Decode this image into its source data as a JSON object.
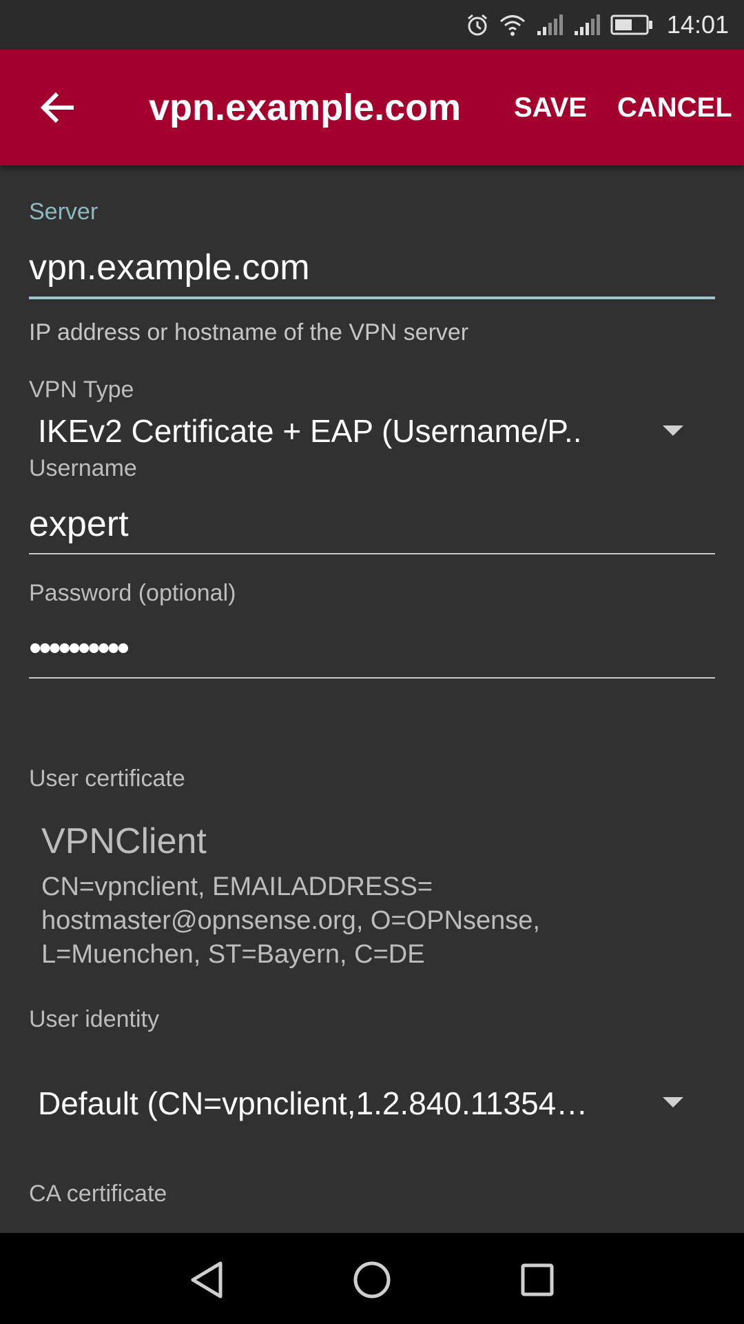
{
  "status_bar": {
    "time": "14:01",
    "icons": [
      "alarm-icon",
      "wifi-icon",
      "signal-icon",
      "signal-icon",
      "battery-icon"
    ]
  },
  "app_bar": {
    "title": "vpn.example.com",
    "save_label": "SAVE",
    "cancel_label": "CANCEL",
    "back_icon": "arrow-back-icon",
    "background_color": "#a4002d"
  },
  "form": {
    "server": {
      "label": "Server",
      "value": "vpn.example.com",
      "helper": "IP address or hostname of the VPN server"
    },
    "vpn_type": {
      "label": "VPN Type",
      "value": "IKEv2 Certificate + EAP (Username/P.."
    },
    "username": {
      "label": "Username",
      "value": "expert"
    },
    "password": {
      "label": "Password (optional)",
      "value": "••••••••••"
    },
    "user_certificate": {
      "label": "User certificate",
      "name": "VPNClient",
      "subject_lines": [
        "CN=vpnclient, EMAILADDRESS=",
        "hostmaster@opnsense.org, O=OPNsense,",
        "L=Muenchen, ST=Bayern, C=DE"
      ]
    },
    "user_identity": {
      "label": "User identity",
      "value": "Default (CN=vpnclient,1.2.840.11354…"
    },
    "ca_certificate": {
      "label": "CA certificate"
    }
  },
  "nav_bar": {
    "icons": [
      "back-triangle-icon",
      "home-circle-icon",
      "recents-square-icon"
    ]
  },
  "colors": {
    "accent": "#9ec7cb",
    "background": "#313131"
  }
}
